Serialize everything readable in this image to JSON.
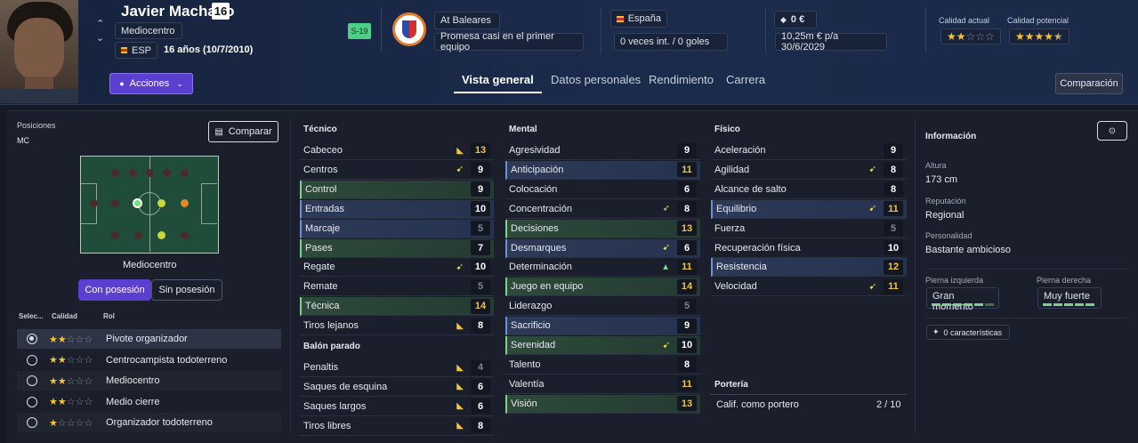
{
  "player": {
    "name": "Javier Machado",
    "number": "16",
    "position": "Mediocentro",
    "nation_code": "ESP",
    "age": "16 años (10/7/2010)",
    "badge": "S-19"
  },
  "header": {
    "actions_label": "Acciones",
    "club": "At Baleares",
    "club_status": "Promesa casi en el primer equipo",
    "country": "España",
    "international": "0 veces int. / 0 goles",
    "value": "0 €",
    "contract": "10,25m € p/a 30/6/2029",
    "current_ability_label": "Calidad actual",
    "potential_ability_label": "Calidad potencial",
    "current_ability_stars": 2,
    "potential_ability_stars": 4.5,
    "compare_label": "Comparación"
  },
  "tabs": [
    {
      "label": "Vista general",
      "active": true
    },
    {
      "label": "Datos personales",
      "active": false
    },
    {
      "label": "Rendimiento",
      "active": false
    },
    {
      "label": "Carrera",
      "active": false
    }
  ],
  "left": {
    "positions_label": "Posiciones",
    "positions_value": "MC",
    "compare_button": "Comparar",
    "pitch_caption": "Mediocentro",
    "in_possession": "Con posesión",
    "out_possession": "Sin posesión",
    "col_select": "Selec...",
    "col_quality": "Calidad",
    "col_role": "Rol",
    "roles": [
      {
        "name": "Pivote organizador",
        "stars": 2,
        "selected": true
      },
      {
        "name": "Centrocampista todoterreno",
        "stars": 2,
        "selected": false
      },
      {
        "name": "Mediocentro",
        "stars": 2,
        "selected": false
      },
      {
        "name": "Medio cierre",
        "stars": 2,
        "selected": false
      },
      {
        "name": "Organizador todoterreno",
        "stars": 1,
        "selected": false
      }
    ]
  },
  "tecnico": {
    "title": "Técnico",
    "items": [
      {
        "name": "Cabeceo",
        "value": "13"
      },
      {
        "name": "Centros",
        "value": "9"
      },
      {
        "name": "Control",
        "value": "9"
      },
      {
        "name": "Entradas",
        "value": "10"
      },
      {
        "name": "Marcaje",
        "value": "5"
      },
      {
        "name": "Pases",
        "value": "7"
      },
      {
        "name": "Regate",
        "value": "10"
      },
      {
        "name": "Remate",
        "value": "5"
      },
      {
        "name": "Técnica",
        "value": "14"
      },
      {
        "name": "Tiros lejanos",
        "value": "8"
      }
    ]
  },
  "balon_parado": {
    "title": "Balón parado",
    "items": [
      {
        "name": "Penaltis",
        "value": "4"
      },
      {
        "name": "Saques de esquina",
        "value": "6"
      },
      {
        "name": "Saques largos",
        "value": "6"
      },
      {
        "name": "Tiros libres",
        "value": "8"
      }
    ]
  },
  "mental": {
    "title": "Mental",
    "items": [
      {
        "name": "Agresividad",
        "value": "9"
      },
      {
        "name": "Anticipación",
        "value": "11"
      },
      {
        "name": "Colocación",
        "value": "6"
      },
      {
        "name": "Concentración",
        "value": "8"
      },
      {
        "name": "Decisiones",
        "value": "13"
      },
      {
        "name": "Desmarques",
        "value": "6"
      },
      {
        "name": "Determinación",
        "value": "11"
      },
      {
        "name": "Juego en equipo",
        "value": "14"
      },
      {
        "name": "Liderazgo",
        "value": "5"
      },
      {
        "name": "Sacrificio",
        "value": "9"
      },
      {
        "name": "Serenidad",
        "value": "10"
      },
      {
        "name": "Talento",
        "value": "8"
      },
      {
        "name": "Valentía",
        "value": "11"
      },
      {
        "name": "Visión",
        "value": "13"
      }
    ]
  },
  "fisico": {
    "title": "Físico",
    "items": [
      {
        "name": "Aceleración",
        "value": "9"
      },
      {
        "name": "Agilidad",
        "value": "8"
      },
      {
        "name": "Alcance de salto",
        "value": "8"
      },
      {
        "name": "Equilibrio",
        "value": "11"
      },
      {
        "name": "Fuerza",
        "value": "5"
      },
      {
        "name": "Recuperación física",
        "value": "10"
      },
      {
        "name": "Resistencia",
        "value": "12"
      },
      {
        "name": "Velocidad",
        "value": "11"
      }
    ]
  },
  "porteria": {
    "title": "Portería",
    "label": "Calif. como portero",
    "value": "2 / 10"
  },
  "info": {
    "title": "Información",
    "height_label": "Altura",
    "height": "173 cm",
    "reputation_label": "Reputación",
    "reputation": "Regional",
    "personality_label": "Personalidad",
    "personality": "Bastante ambicioso",
    "left_foot_label": "Pierna izquierda",
    "left_foot": "Gran momento",
    "right_foot_label": "Pierna derecha",
    "right_foot": "Muy fuerte",
    "traits": "0 características"
  },
  "colors": {
    "accent_purple": "#5b3fd0",
    "value_yellow": "#f2c53d",
    "green_bar": "#7fd08e"
  }
}
